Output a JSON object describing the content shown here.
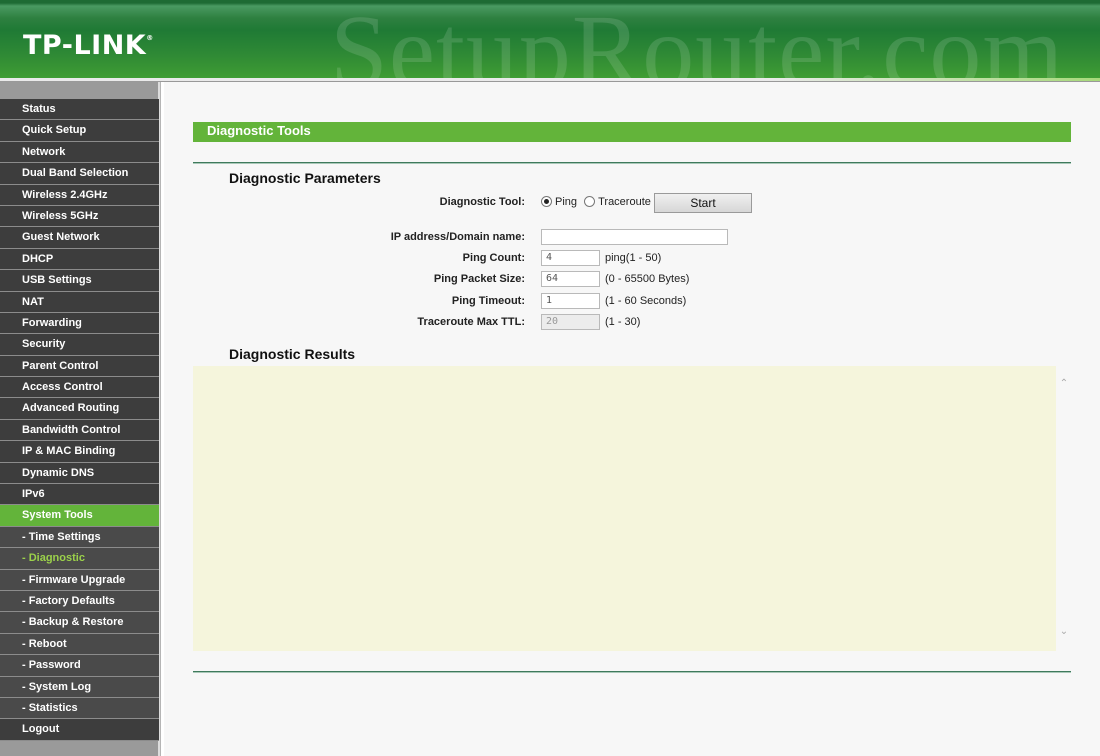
{
  "header": {
    "brand": "TP-LINK",
    "registered_mark": "®",
    "watermark": "SetupRouter.com"
  },
  "sidebar": {
    "items": [
      {
        "label": "Status",
        "type": "main"
      },
      {
        "label": "Quick Setup",
        "type": "main"
      },
      {
        "label": "Network",
        "type": "main"
      },
      {
        "label": "Dual Band Selection",
        "type": "main"
      },
      {
        "label": "Wireless 2.4GHz",
        "type": "main"
      },
      {
        "label": "Wireless 5GHz",
        "type": "main"
      },
      {
        "label": "Guest Network",
        "type": "main"
      },
      {
        "label": "DHCP",
        "type": "main"
      },
      {
        "label": "USB Settings",
        "type": "main"
      },
      {
        "label": "NAT",
        "type": "main"
      },
      {
        "label": "Forwarding",
        "type": "main"
      },
      {
        "label": "Security",
        "type": "main"
      },
      {
        "label": "Parent Control",
        "type": "main"
      },
      {
        "label": "Access Control",
        "type": "main"
      },
      {
        "label": "Advanced Routing",
        "type": "main"
      },
      {
        "label": "Bandwidth Control",
        "type": "main"
      },
      {
        "label": "IP & MAC Binding",
        "type": "main"
      },
      {
        "label": "Dynamic DNS",
        "type": "main"
      },
      {
        "label": "IPv6",
        "type": "main"
      },
      {
        "label": "System Tools",
        "type": "active-parent"
      },
      {
        "label": "- Time Settings",
        "type": "sub"
      },
      {
        "label": "- Diagnostic",
        "type": "current"
      },
      {
        "label": "- Firmware Upgrade",
        "type": "sub"
      },
      {
        "label": "- Factory Defaults",
        "type": "sub"
      },
      {
        "label": "- Backup & Restore",
        "type": "sub"
      },
      {
        "label": "- Reboot",
        "type": "sub"
      },
      {
        "label": "- Password",
        "type": "sub"
      },
      {
        "label": "- System Log",
        "type": "sub"
      },
      {
        "label": "- Statistics",
        "type": "sub"
      },
      {
        "label": "Logout",
        "type": "main"
      }
    ]
  },
  "main": {
    "page_title": "Diagnostic Tools",
    "params_title": "Diagnostic Parameters",
    "results_title": "Diagnostic Results",
    "diagnostic_tool": {
      "label": "Diagnostic Tool:",
      "options": [
        "Ping",
        "Traceroute"
      ],
      "selected": "Ping",
      "start_label": "Start"
    },
    "ip_address": {
      "label": "IP address/Domain name:",
      "value": ""
    },
    "ping_count": {
      "label": "Ping Count:",
      "value": "4",
      "hint": "ping(1 - 50)"
    },
    "ping_packet_size": {
      "label": "Ping Packet Size:",
      "value": "64",
      "hint": "(0 - 65500 Bytes)"
    },
    "ping_timeout": {
      "label": "Ping Timeout:",
      "value": "1",
      "hint": "(1 - 60 Seconds)"
    },
    "traceroute_ttl": {
      "label": "Traceroute Max TTL:",
      "value": "20",
      "hint": "(1 - 30)"
    },
    "results_text": ""
  },
  "colors": {
    "brand_green": "#63b43a",
    "header_green": "#1f7a35",
    "nav_dark": "#3d3d3d",
    "results_bg": "#f5f5dc",
    "current_item": "#9bd14a"
  }
}
